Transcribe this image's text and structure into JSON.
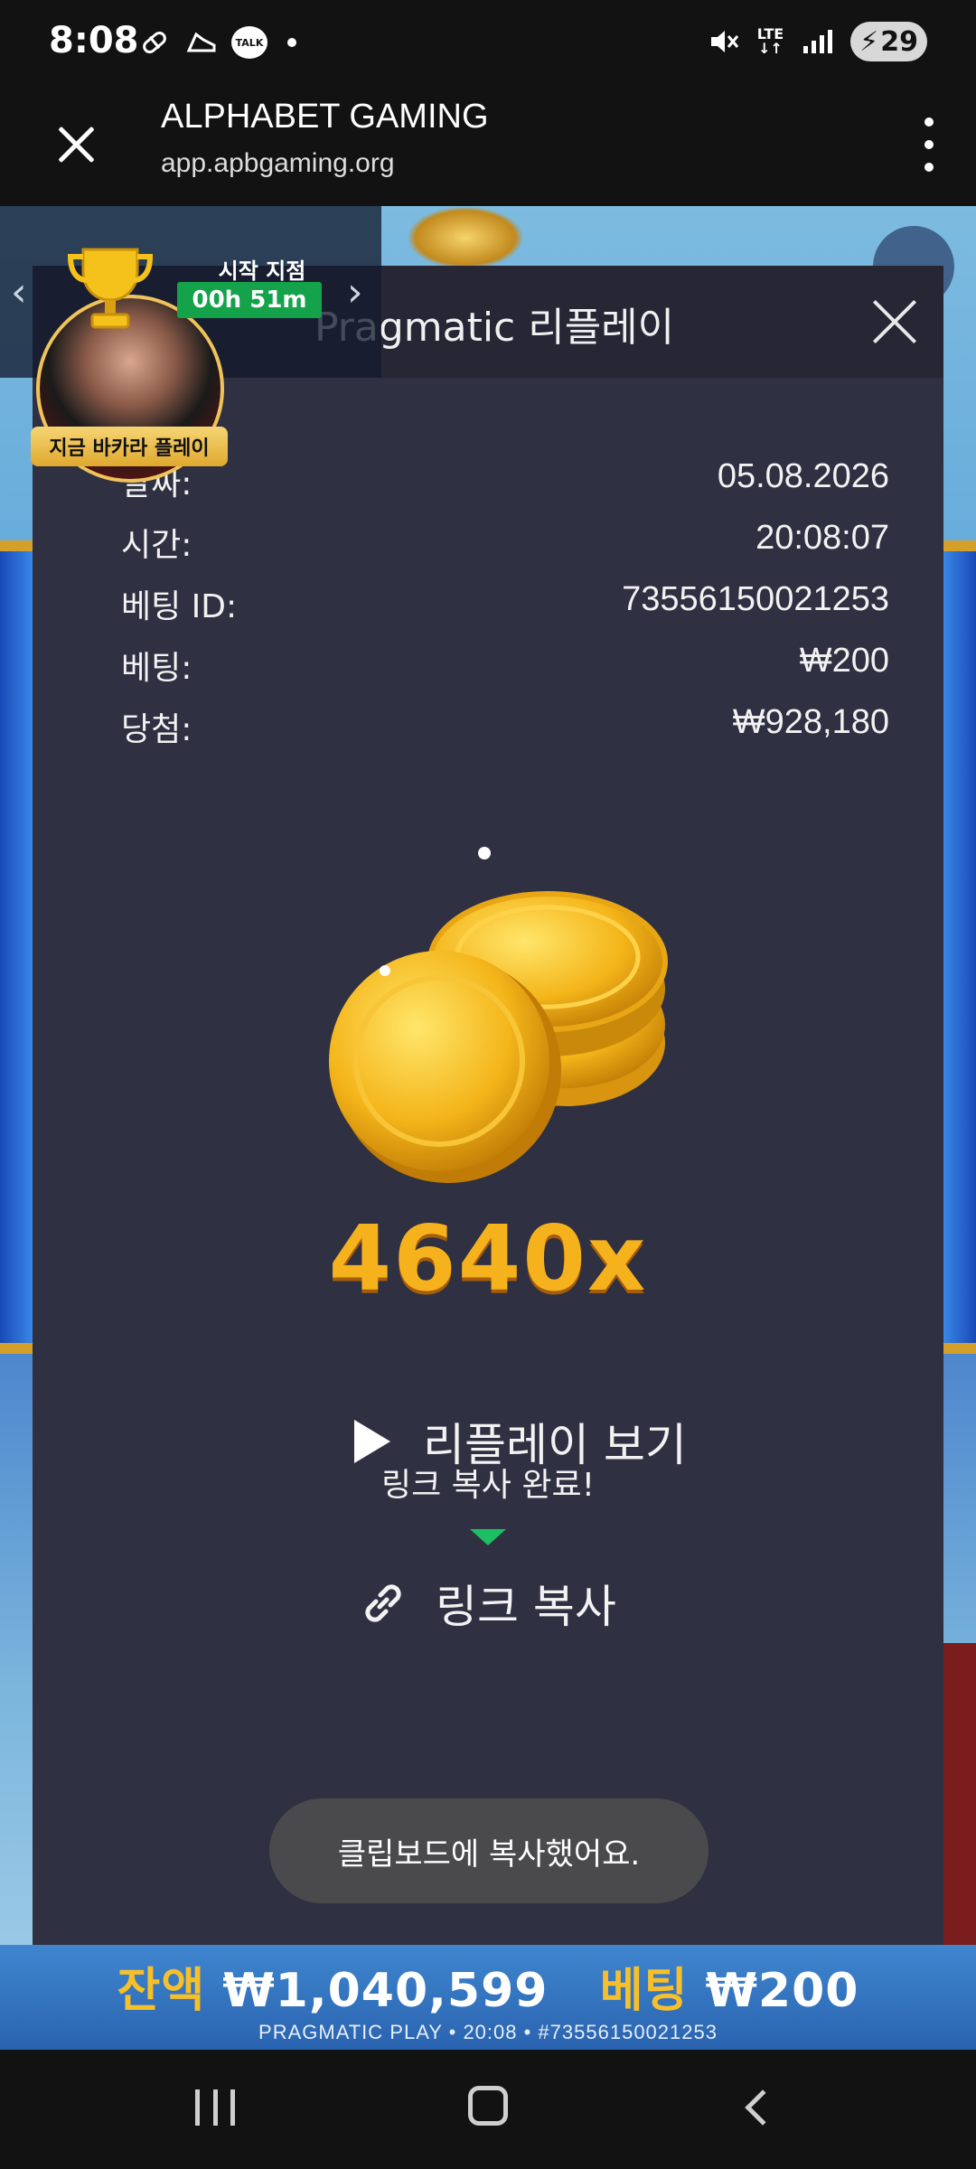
{
  "status_bar": {
    "time": "8:08",
    "talk_label": "TALK",
    "network": "LTE",
    "battery": "29"
  },
  "browser": {
    "title": "ALPHABET GAMING",
    "url": "app.apbgaming.org"
  },
  "promo": {
    "start_label": "시작 지점",
    "timer": "00h 51m",
    "play_badge": "지금 바카라 플레이"
  },
  "modal": {
    "title": "Pragmatic 리플레이",
    "rows": [
      {
        "label": "날짜:",
        "value": "05.08.2026"
      },
      {
        "label": "시간:",
        "value": "20:08:07"
      },
      {
        "label": "베팅 ID:",
        "value": "73556150021253"
      },
      {
        "label": "베팅:",
        "value": "₩200"
      },
      {
        "label": "당첨:",
        "value": "₩928,180"
      }
    ],
    "multiplier": "4640x",
    "replay_button": "리플레이 보기",
    "copied_message": "링크 복사 완료!",
    "copy_link_button": "링크 복사"
  },
  "toast": "클립보드에 복사했어요.",
  "game_bar": {
    "balance_label": "잔액",
    "balance_value": "₩1,040,599",
    "bet_label": "베팅",
    "bet_value": "₩200",
    "footer": "PRAGMATIC PLAY • 20:08 • #73556150021253"
  },
  "colors": {
    "modal_bg": "#2f3041",
    "modal_header_bg": "#262635",
    "multiplier": "#f6b21c",
    "timer_bg": "#14a24a",
    "balance_label": "#f7c02b"
  },
  "icons": [
    "close-icon",
    "more-vert-icon",
    "play-icon",
    "link-icon",
    "trophy-icon",
    "chevron-left-icon",
    "chevron-right-icon",
    "coins-icon",
    "recent-apps-icon",
    "home-icon",
    "back-icon"
  ]
}
